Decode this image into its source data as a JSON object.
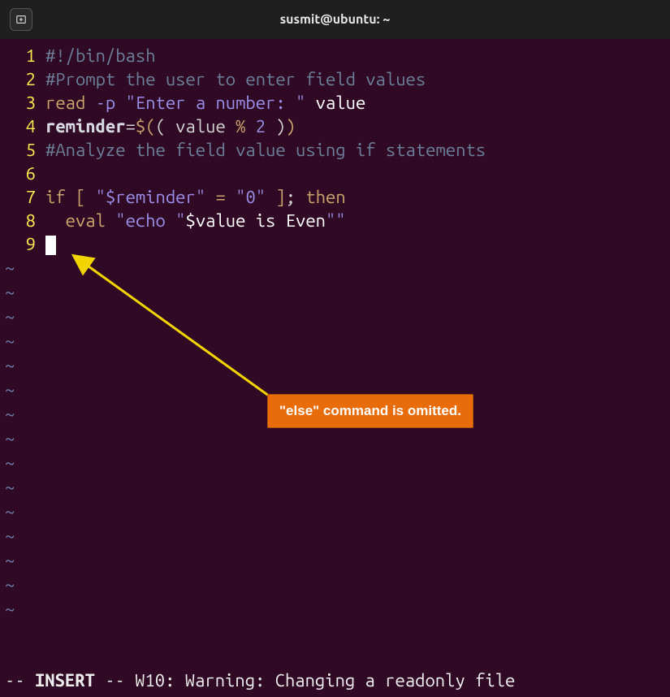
{
  "titlebar": {
    "title": "susmit@ubuntu: ~"
  },
  "code": {
    "lines": [
      {
        "n": "1",
        "t": [
          [
            "comment",
            "#!/bin/bash"
          ]
        ]
      },
      {
        "n": "2",
        "t": [
          [
            "comment",
            "#Prompt the user to enter field values"
          ]
        ]
      },
      {
        "n": "3",
        "t": [
          [
            "builtin",
            "read"
          ],
          [
            "op",
            " "
          ],
          [
            "flag",
            "-p"
          ],
          [
            "op",
            " "
          ],
          [
            "string",
            "\"Enter a number: \""
          ],
          [
            "op",
            " "
          ],
          [
            "white",
            "value"
          ]
        ]
      },
      {
        "n": "4",
        "t": [
          [
            "var",
            "reminder"
          ],
          [
            "op",
            "="
          ],
          [
            "builtin",
            "$("
          ],
          [
            "paren",
            "("
          ],
          [
            "op",
            " value "
          ],
          [
            "builtin",
            "%"
          ],
          [
            "op",
            " "
          ],
          [
            "num",
            "2"
          ],
          [
            "op",
            " "
          ],
          [
            "paren",
            ")"
          ],
          [
            "builtin",
            ")"
          ]
        ]
      },
      {
        "n": "5",
        "t": [
          [
            "comment",
            "#Analyze the field value using if statements"
          ]
        ]
      },
      {
        "n": "6",
        "t": []
      },
      {
        "n": "7",
        "t": [
          [
            "keyword",
            "if"
          ],
          [
            "op",
            " "
          ],
          [
            "builtin",
            "["
          ],
          [
            "op",
            " "
          ],
          [
            "string",
            "\"$reminder\""
          ],
          [
            "op",
            " "
          ],
          [
            "builtin",
            "="
          ],
          [
            "op",
            " "
          ],
          [
            "string",
            "\"0\""
          ],
          [
            "op",
            " "
          ],
          [
            "builtin",
            "]"
          ],
          [
            "op",
            "; "
          ],
          [
            "keyword",
            "then"
          ]
        ]
      },
      {
        "n": "8",
        "t": [
          [
            "op",
            "  "
          ],
          [
            "builtin",
            "eval"
          ],
          [
            "op",
            " "
          ],
          [
            "string",
            "\"echo \""
          ],
          [
            "white",
            "$value is Even"
          ],
          [
            "string",
            "\"\""
          ]
        ]
      },
      {
        "n": "9",
        "t": [
          [
            "cursor",
            ""
          ]
        ]
      }
    ]
  },
  "tilde": "~",
  "tilde_count": 15,
  "status": {
    "prefix": "-- ",
    "mode": "INSERT",
    "suffix": " -- ",
    "warning": "W10: Warning: Changing a readonly file"
  },
  "annotation": {
    "text": "\"else\" command is omitted."
  }
}
